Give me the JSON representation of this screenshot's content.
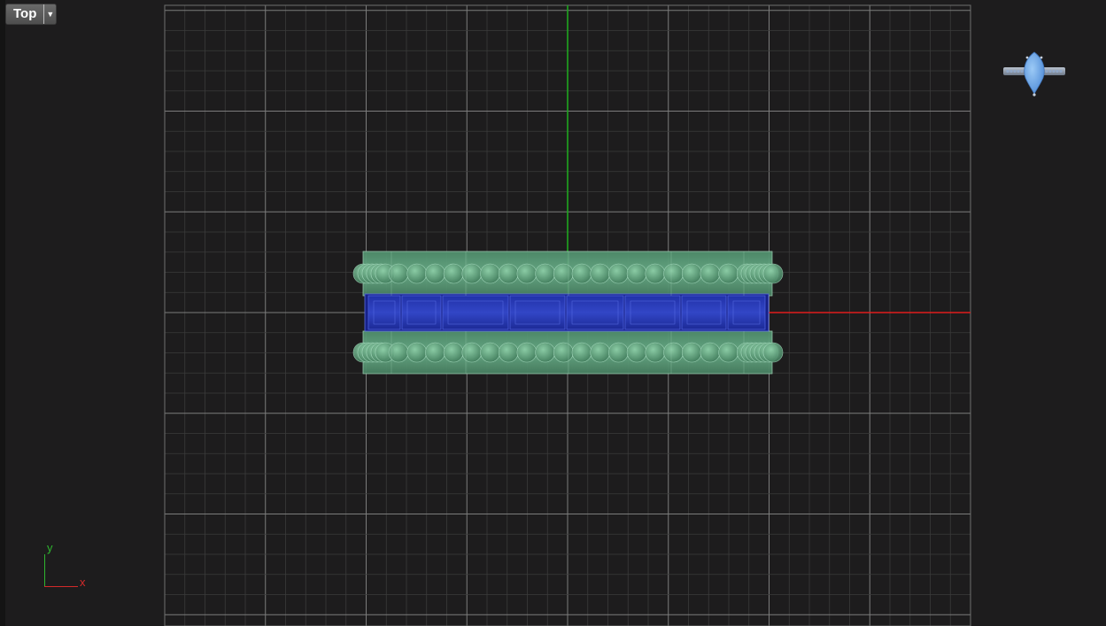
{
  "viewport": {
    "view_name": "Top",
    "dropdown_icon": "triangle-down-icon"
  },
  "axis_gizmo": {
    "y_label": "y",
    "x_label": "x"
  },
  "colors": {
    "background": "#1d1c1d",
    "grid_minor": "#3b3b3b",
    "grid_major": "#7c7c7c",
    "x_axis": "#e01c1c",
    "y_axis": "#1fa61f",
    "metal_green": "#5fa27d",
    "gem_blue": "#2639b4",
    "thumb_gem": "#6aa6ea"
  },
  "scene_objects": [
    "ring-band-top-view",
    "channel-set-gemstones",
    "bead-row-upper",
    "bead-row-lower"
  ],
  "thumbnail_icon": "pear-ring-preview-icon"
}
